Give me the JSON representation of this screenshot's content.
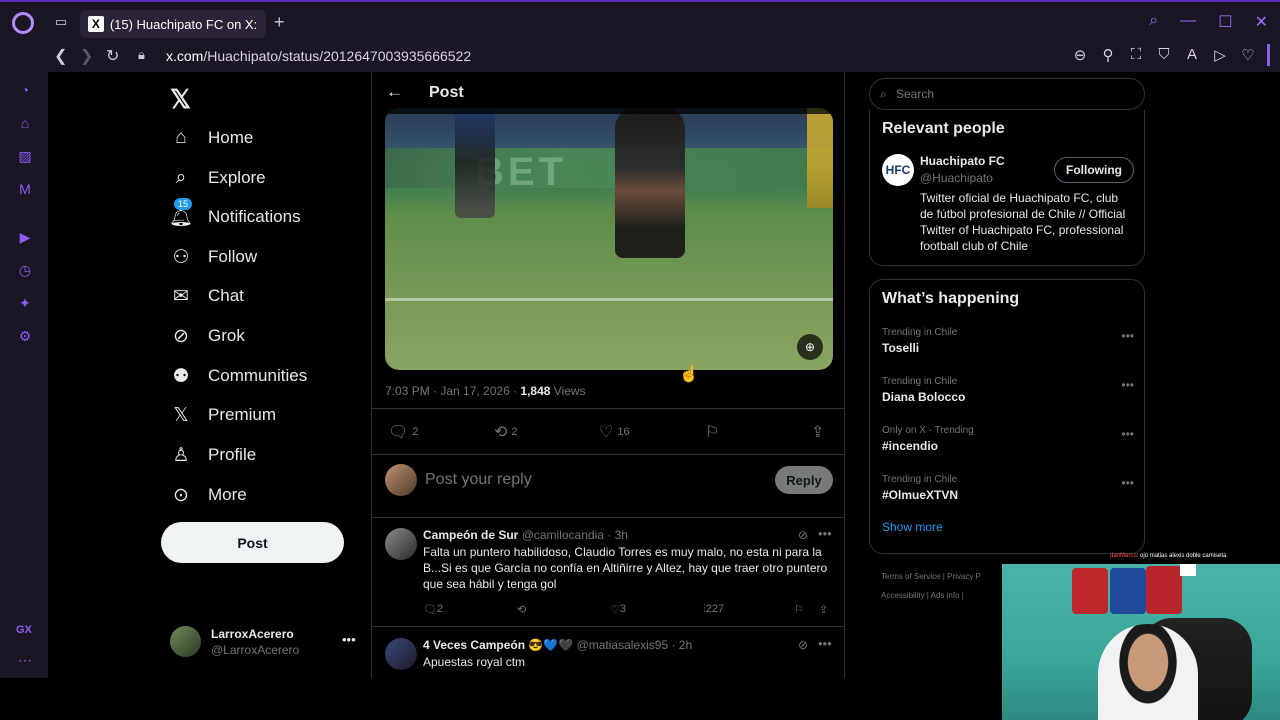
{
  "browser": {
    "tab_title": "(15) Huachipato FC on X: \"…",
    "url_host": "x.com",
    "url_path": "/Huachipato/status/2012647003935666522"
  },
  "nav": {
    "items": [
      {
        "label": "Home",
        "icon": "home-icon"
      },
      {
        "label": "Explore",
        "icon": "search-icon"
      },
      {
        "label": "Notifications",
        "icon": "bell-icon",
        "badge": "15"
      },
      {
        "label": "Follow",
        "icon": "person-plus-icon"
      },
      {
        "label": "Chat",
        "icon": "envelope-icon"
      },
      {
        "label": "Grok",
        "icon": "grok-icon"
      },
      {
        "label": "Communities",
        "icon": "people-icon"
      },
      {
        "label": "Premium",
        "icon": "x-icon"
      },
      {
        "label": "Profile",
        "icon": "person-icon"
      },
      {
        "label": "More",
        "icon": "more-circle-icon"
      }
    ],
    "post_button": "Post"
  },
  "account": {
    "name": "LarroxAcerero",
    "handle": "@LarroxAcerero"
  },
  "post": {
    "header_title": "Post",
    "time": "7:03 PM · Jan 17, 2026 · ",
    "views_count": "1,848",
    "views_label": " Views",
    "replies": "2",
    "reposts": "2",
    "likes": "16",
    "reply_placeholder": "Post your reply",
    "reply_button": "Reply"
  },
  "comments": [
    {
      "name": "Campeón de Sur",
      "handle": "@camilocandia · 3h",
      "text": "Falta un puntero habilidoso, Claudio Torres es muy malo, no esta ni para la B...Si es que García no confía en Altiñirre y Altez, hay que traer otro puntero que sea hábil y tenga gol",
      "replies": "2",
      "likes": "3",
      "views": "227"
    },
    {
      "name": "4 Veces Campeón 😎💙🖤",
      "handle": "@matiasalexis95 · 2h",
      "text": "Apuestas royal ctm"
    }
  ],
  "right": {
    "search_placeholder": "Search",
    "relevant_title": "Relevant people",
    "person": {
      "name": "Huachipato FC",
      "handle": "@Huachipato",
      "follow_label": "Following",
      "bio": "Twitter oficial de Huachipato FC, club de fútbol profesional de Chile // Official Twitter of Huachipato FC, professional football club of Chile"
    },
    "happening_title": "What’s happening",
    "trends": [
      {
        "context": "Trending in Chile",
        "name": "Toselli"
      },
      {
        "context": "Trending in Chile",
        "name": "Diana Bolocco"
      },
      {
        "context": "Only on X · Trending",
        "name": "#incendio"
      },
      {
        "context": "Trending in Chile",
        "name": "#OlmueXTVN"
      }
    ],
    "show_more": "Show more",
    "footer": "Terms of Service  |  Privacy P",
    "footer2": "Accessibility  |  Ads info  |"
  },
  "overlay": {
    "chat_user": "danMarco",
    "chat_text": ": ojo matias alexis doble camiseta"
  },
  "colors": {
    "accent": "#1d9bf0",
    "opera_purple": "#8b5cf6"
  }
}
